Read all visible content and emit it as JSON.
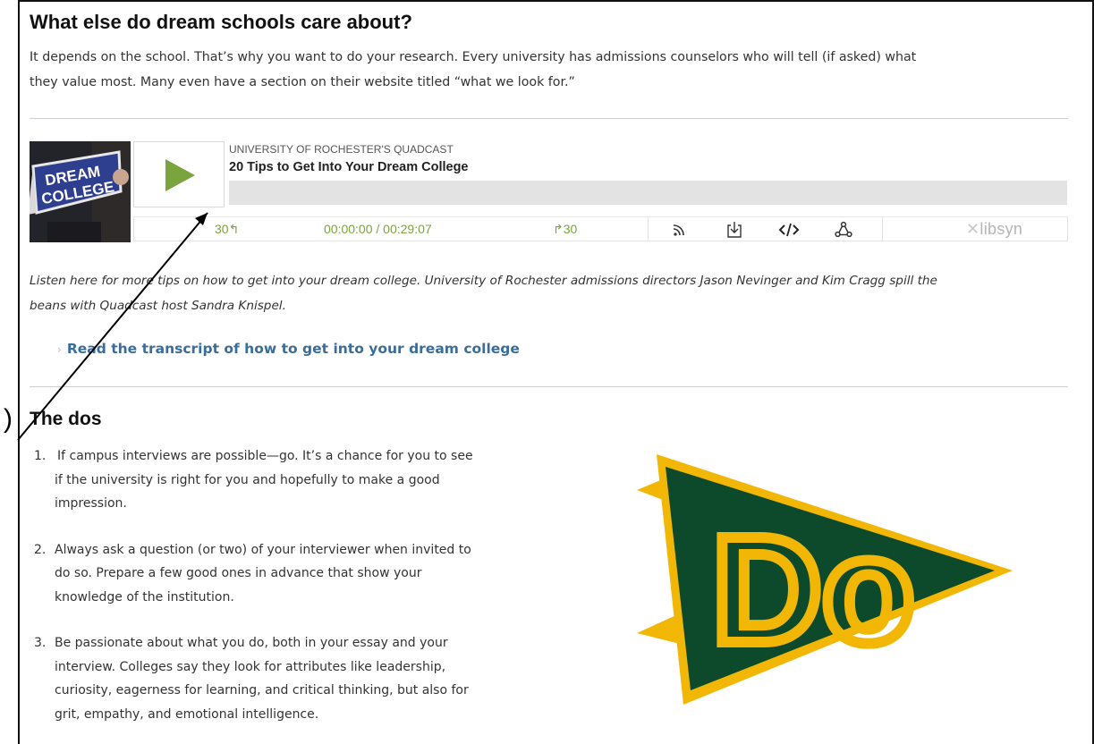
{
  "section1": {
    "heading": "What else do dream schools care about?",
    "paragraph_line1": "It depends on the school. That’s why you want to do your research. Every university has admissions counselors who will tell (if asked) what",
    "paragraph_line2": "they value most. Many even have a section on their website titled “what we look for.”"
  },
  "player": {
    "artwork_text_line1": "DREAM",
    "artwork_text_line2": "COLLEGE",
    "show_name": "UNIVERSITY OF ROCHESTER'S QUADCAST",
    "episode_title": "20 Tips to Get Into Your Dream College",
    "rewind_label": "30↰",
    "time_display": "00:00:00 / 00:29:07",
    "forward_label": "↱30",
    "brand": "libsyn",
    "progress": 0,
    "accent_color": "#7aa43d",
    "icons": [
      "play-icon",
      "rss-icon",
      "download-icon",
      "embed-code-icon",
      "share-icon",
      "libsyn-logo"
    ]
  },
  "caption": {
    "line1": "Listen here for more tips on how to get into your dream college. University of Rochester admissions directors Jason Nevinger and Kim Cragg spill the",
    "line2": "beans with Quadcast host Sandra Knispel."
  },
  "transcript_link": {
    "chevron": "›",
    "label": "Read the transcript of how to get into your dream college",
    "color": "#3a6d99"
  },
  "section2": {
    "heading": "The dos",
    "items": [
      {
        "num": "1.",
        "lines": [
          "If campus interviews are possible—go. It’s a chance for you to see",
          "if the university is right for you and hopefully to make a good",
          "impression."
        ]
      },
      {
        "num": "2.",
        "lines": [
          "Always ask a question (or two) of your interviewer when invited to",
          "do so. Prepare a few good ones in advance that show your",
          "knowledge of the institution."
        ]
      },
      {
        "num": "3.",
        "lines": [
          "Be passionate about what you do, both in your essay and your",
          "interview. Colleges say they look for attributes like leadership,",
          "curiosity, eagerness for learning, and critical thinking, but also for",
          "grit, empathy, and emotional intelligence."
        ]
      }
    ]
  },
  "pennant": {
    "text": "Do",
    "field_color": "#0d4a2c",
    "trim_color": "#f2b705"
  },
  "annotation": {
    "bracket": ")"
  }
}
